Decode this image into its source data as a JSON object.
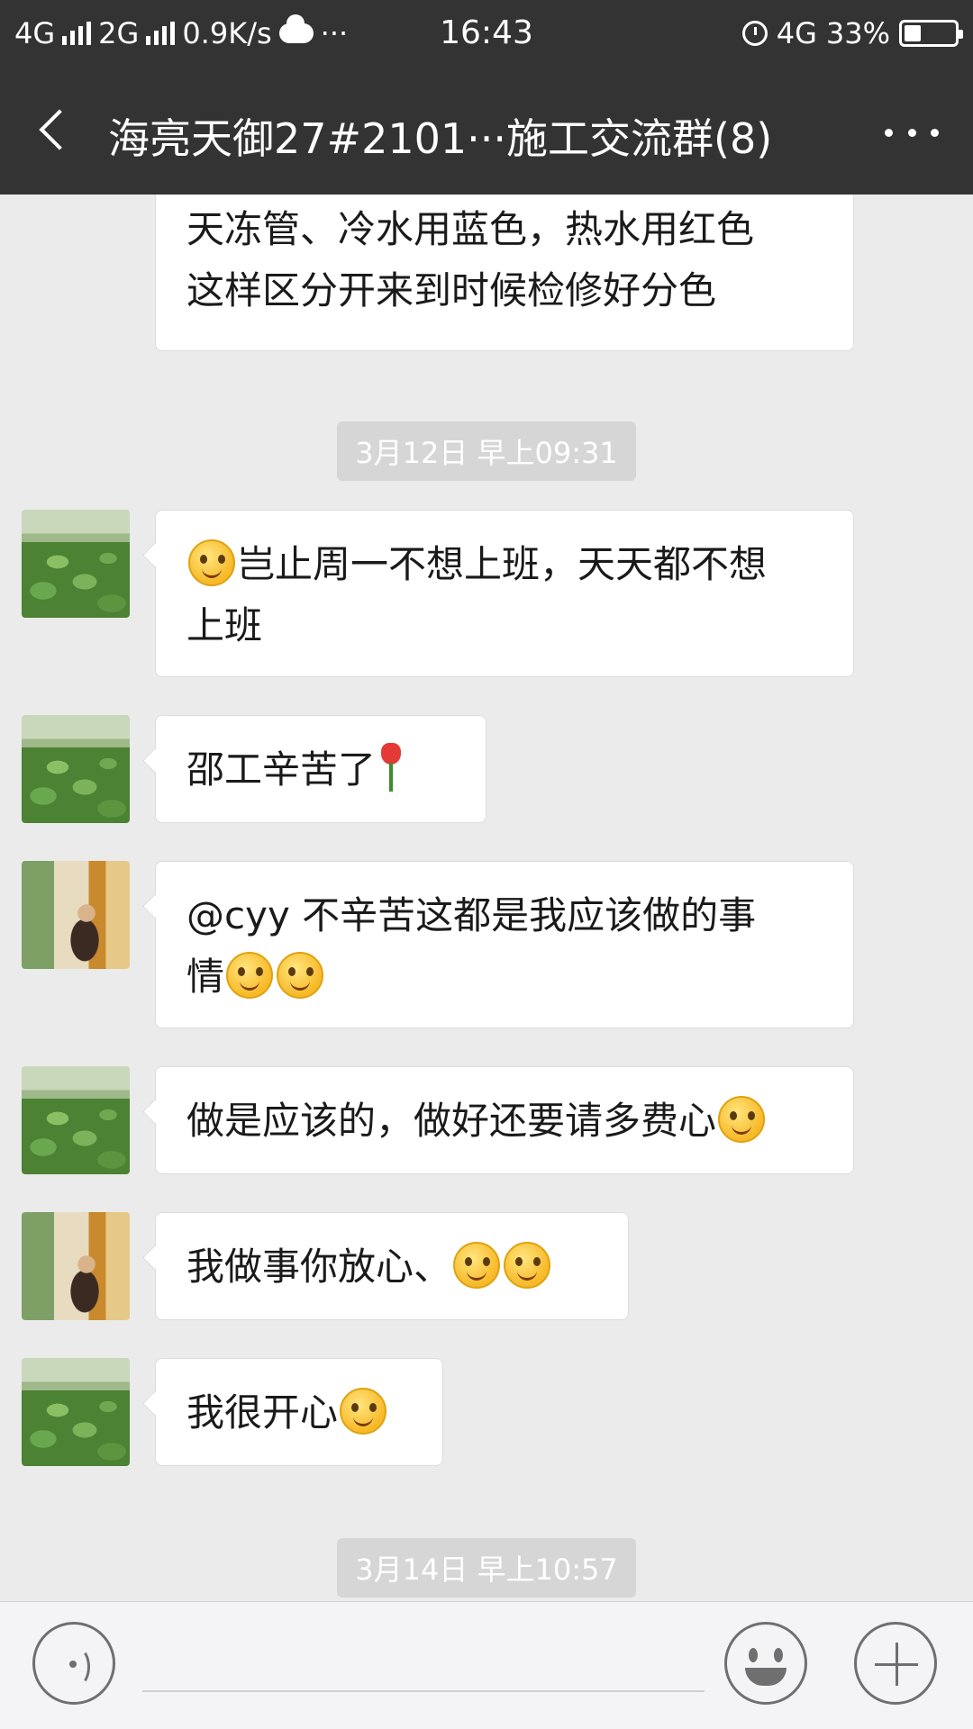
{
  "status_bar": {
    "net1": "4G",
    "net2": "2G",
    "speed": "0.9K/s",
    "more": "···",
    "time": "16:43",
    "net_right": "4G",
    "battery": "33%",
    "battery_level": 0.33
  },
  "header": {
    "title": "海亮天御27#2101···施工交流群(8)"
  },
  "messages": [
    {
      "sender_avatar": "monk-avatar",
      "text_lines": [
        "天冻管、冷水用蓝色，热水用红色",
        "这样区分开来到时候检修好分色"
      ]
    },
    {
      "timestamp": "3月12日 早上09:31"
    },
    {
      "sender_avatar": "lotus-avatar",
      "emoji_before": "thinking-face",
      "line1": "岂止周一不想上班，天天都不想",
      "line2": "上班"
    },
    {
      "sender_avatar": "lotus-avatar",
      "text": "邵工辛苦了",
      "emoji_after": "rose"
    },
    {
      "sender_avatar": "monk-avatar",
      "line1": "@cyy  不辛苦这都是我应该做的事",
      "line2": "情",
      "emoji_after": "smiling-face x2"
    },
    {
      "sender_avatar": "lotus-avatar",
      "text": "做是应该的，做好还要请多费心",
      "emoji_after": "blush-face"
    },
    {
      "sender_avatar": "monk-avatar",
      "text": "我做事你放心、",
      "emoji_after": "blush-face x2"
    },
    {
      "sender_avatar": "lotus-avatar",
      "text": "我很开心",
      "emoji_after": "smile-face"
    },
    {
      "timestamp": "3月14日 早上10:57"
    }
  ],
  "input_bar": {
    "placeholder": ""
  },
  "colors": {
    "bar_bg": "#333333",
    "chat_bg": "#ebebeb",
    "bubble_bg": "#ffffff",
    "timestamp_bg": "#d6d6d6"
  }
}
